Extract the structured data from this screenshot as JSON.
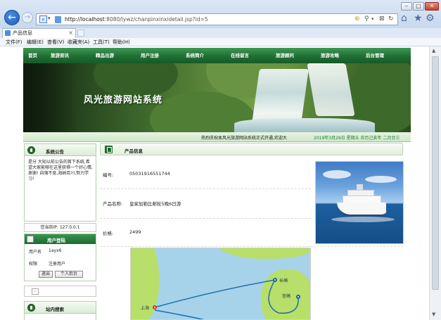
{
  "browser": {
    "url_host": "http://localhost",
    "url_path": ":8080/lywz/chanpinxinxidetail.jsp?id=5",
    "tab_title": "产品信息",
    "menu": [
      "文件(F)",
      "编辑(E)",
      "查看(V)",
      "收藏夹(A)",
      "工具(T)",
      "帮助(H)"
    ]
  },
  "site": {
    "nav": [
      "首页",
      "旅游资讯",
      "精品出游",
      "用户注册",
      "系统简介",
      "在线留言",
      "旅游顾问",
      "旅游攻略",
      "后台管理"
    ],
    "banner_title": "风光旅游网站系统",
    "ticker_message": "热烈庆祝本风光旅游网站系统正式开通,欢迎大",
    "ticker_date": "2019年3月29日 星期五 农历己亥年 二月廿三"
  },
  "sidebar": {
    "notice_title": "系统公告",
    "notice_text": "是分 大知以前公告的首下系统,希望大家能够在这里获得一个好心情,谢谢!  自强不息,海纳百川,努力学习!",
    "ip_label": "您当前IP: 127.0.0.1",
    "login_title": "用户登陆",
    "username_label": "用户名",
    "username_value": "1ayx6",
    "role_label": "权限",
    "role_value": "注册用户",
    "logout_button": "退出",
    "personal_button": "个人后台",
    "mini_box": "◦",
    "search_title": "站内搜索"
  },
  "product": {
    "section_title": "产品信息",
    "number_label": "编号:",
    "number_value": "05031916551744",
    "name_label": "产品名称:",
    "name_value": "皇家加勒比邮轮5晚6日游",
    "price_label": "价格:",
    "price_value": "2499"
  },
  "map": {
    "cities": [
      "上海",
      "长崎",
      "宫崎"
    ]
  },
  "colors": {
    "nav_green": "#1f6e33",
    "accent_blue": "#1d5fb8"
  }
}
